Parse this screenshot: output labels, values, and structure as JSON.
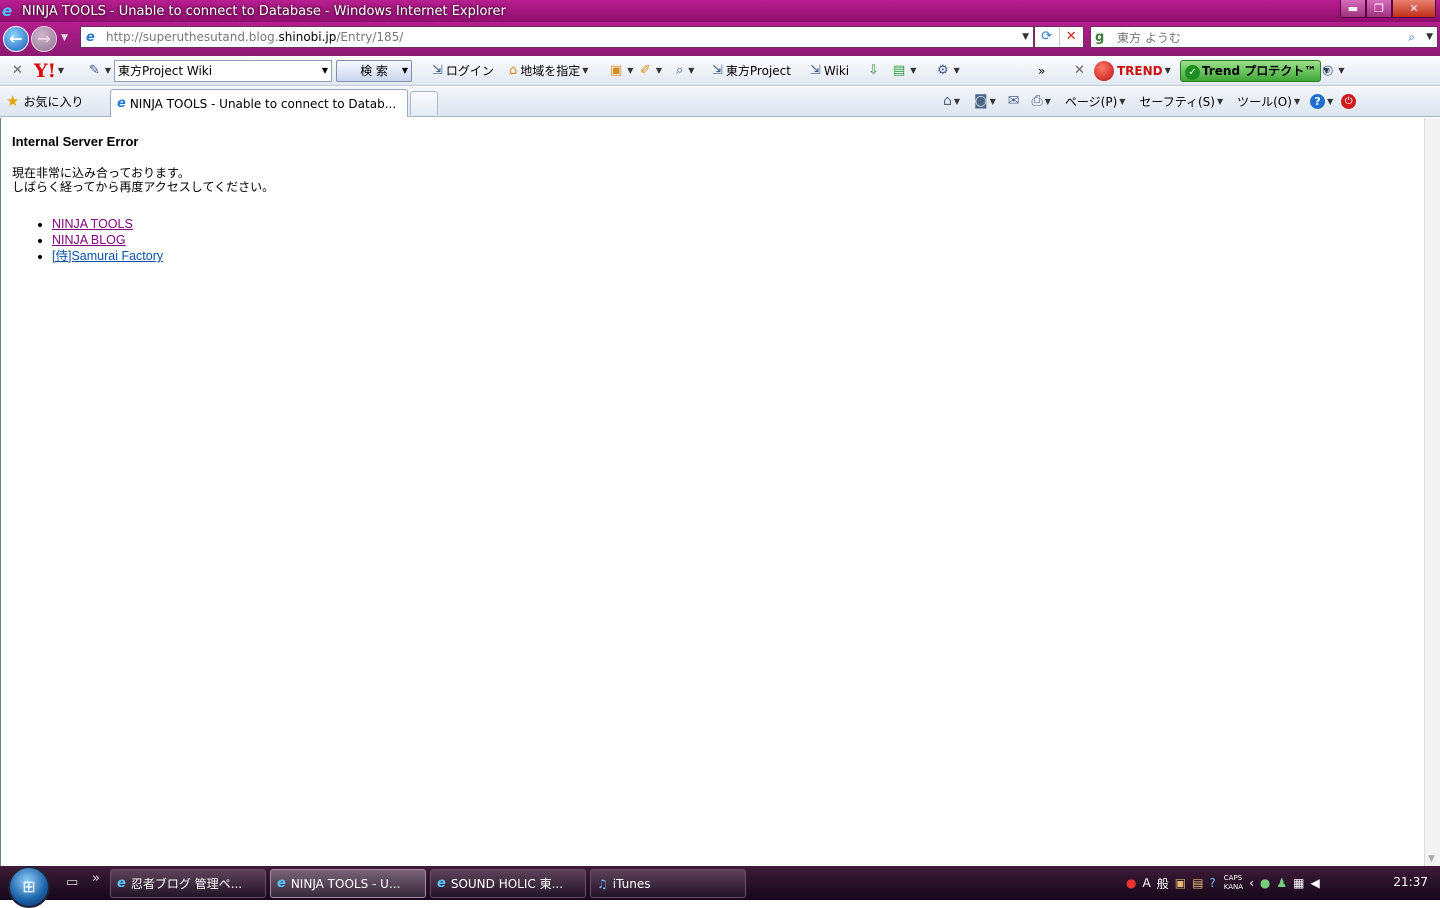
{
  "window": {
    "title": "NINJA TOOLS - Unable to connect to Database - Windows Internet Explorer",
    "minimize": "▬",
    "maximize": "❐",
    "close": "✕"
  },
  "address": {
    "url_prefix": "http://superuthesutand.blog.",
    "url_domain": "shinobi.jp",
    "url_path": "/Entry/185/",
    "search_text": "東方 ようむ"
  },
  "toolbar": {
    "yahoo_logo": "Y!",
    "search_value": "東方Project Wiki",
    "search_button": "検 索",
    "login": "ログイン",
    "region": "地域を指定",
    "touhou_project": "東方Project",
    "wiki": "Wiki",
    "overflow": "»",
    "trend_logo": "TREND",
    "trend_button": "Trend プロテクト™"
  },
  "tabs": {
    "favorites": "お気に入り",
    "active_tab": "NINJA TOOLS - Unable to connect to Datab..."
  },
  "commandbar": {
    "page": "ページ(P)",
    "safety": "セーフティ(S)",
    "tools": "ツール(O)"
  },
  "page": {
    "heading": "Internal Server Error",
    "message_line1": "現在非常に込み合っております。",
    "message_line2": "しばらく経ってから再度アクセスしてください。",
    "links": [
      "NINJA TOOLS",
      "NINJA BLOG",
      "[侍]Samurai Factory"
    ]
  },
  "taskbar": {
    "tasks": [
      "忍者ブログ 管理ペ...",
      "NINJA TOOLS - U...",
      "SOUND HOLIC 東...",
      "iTunes"
    ],
    "ime_mode": "A",
    "ime_kanji": "般",
    "caps": "CAPS",
    "kana": "KANA",
    "clock": "21:37"
  }
}
